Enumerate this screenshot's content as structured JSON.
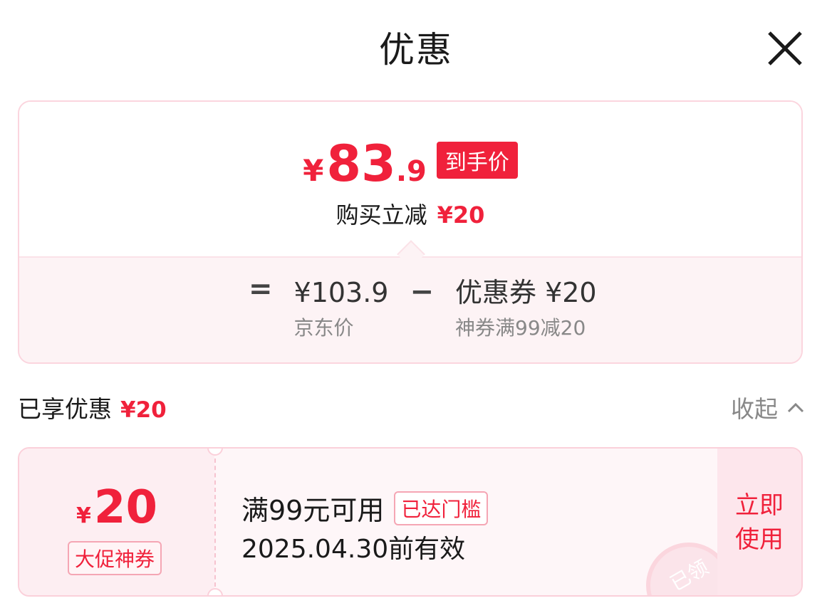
{
  "header": {
    "title": "优惠",
    "close_icon": "close-icon"
  },
  "price_summary": {
    "final_price": {
      "currency": "¥",
      "integer": "83",
      "decimal": ".9"
    },
    "final_badge": "到手价",
    "reduce_label": "购买立减",
    "reduce_amount": "¥20",
    "formula": {
      "equals": "=",
      "jd_price": "¥103.9",
      "jd_label": "京东价",
      "minus": "−",
      "coupon_value": "优惠券 ¥20",
      "coupon_label": "神券满99减20"
    }
  },
  "enjoyed": {
    "label": "已享优惠",
    "amount": "¥20",
    "collapse_label": "收起"
  },
  "coupon": {
    "currency": "¥",
    "amount": "20",
    "tag": "大促神券",
    "condition": "满99元可用",
    "reached_badge": "已达门槛",
    "expiry": "2025.04.30前有效",
    "use_button": "立即使用",
    "stamp_text": "已领"
  },
  "colors": {
    "accent": "#f0213b",
    "coupon_bg": "#fef6f8",
    "border": "#fbd0da"
  }
}
